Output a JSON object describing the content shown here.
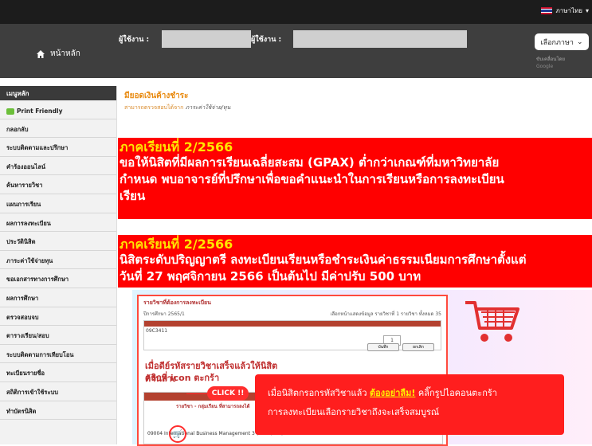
{
  "topbar": {
    "language_label": "ภาษาไทย",
    "chevron": "chevron-down-icon"
  },
  "header": {
    "home_label": "หน้าหลัก",
    "user_label_1": "ผู้ใช้งาน :",
    "user_label_2": "ผู้ใช้งาน : ",
    "language_select": "เลือกภาษา",
    "powered_by": "ขับเคลื่อนโดย",
    "google": "Google"
  },
  "sidebar": {
    "heading": "เมนูหลัก",
    "items": [
      "Print Friendly",
      "กลอกลับ",
      "ระบบติดตามและปรึกษา",
      "คำร้องออนไลน์",
      "ค้นหารายวิชา",
      "แผนการเรียน",
      "ผลการลงทะเบียน",
      "ประวัตินิสิต",
      "ภาระค่าใช้จ่ายทุน",
      "ขอเอกสารทางการศึกษา",
      "ผลการศึกษา",
      "ตรวจสอบจบ",
      "ตารางเรียน/สอบ",
      "ระบบติดตามการเทียบโอน",
      "ทะเบียนรายชื่อ",
      "สถิติการเข้าใช้ระบบ",
      "ทำบัตรนิสิต"
    ]
  },
  "notice": {
    "title": "มียอดเงินค้างชำระ",
    "subtitle": "สามารถตรวจสอบได้จาก",
    "subtitle_link": "ภาระค่าใช้จ่าย/ทุน"
  },
  "banner1": {
    "term": "ภาคเรียนที่ 2/2566",
    "lines": [
      "ขอให้นิสิตที่มีผลการเรียนเฉลี่ยสะสม (GPAX) ต่ำกว่าเกณฑ์ที่มหาวิทยาลัย",
      "กำหนด พบอาจารย์ที่ปรึกษาเพื่อขอคำแนะนำในการเรียนหรือการลงทะเบียน",
      "เรียน"
    ]
  },
  "banner2": {
    "term": "ภาคเรียนที่ 2/2566",
    "lines": [
      "นิสิตระดับปริญญาตรี ลงทะเบียนเรียนหรือชำระเงินค่าธรรมเนียมการศึกษาตั้งแต่",
      "วันที่ 27 พฤศจิกายน 2566 เป็นต้นไป มีค่าปรับ 500 บาท"
    ]
  },
  "poster": {
    "frame_title": "รายวิชาที่ต้องการลงทะเบียน",
    "term_row_left": "ปีการศึกษา 2565/1",
    "term_row_right": "เลือกหน้าแสดงข้อมูล  รายวิชาที่ 1  รายวิชา  ทั้งหมด 35",
    "course_code": "09C3411",
    "qty": "1",
    "btn_save": "บันทึก",
    "btn_cancel": "ยกเลิก",
    "big_text_1": "เมื่อดีย์รหัสรายวิชาเสร็จแล้วให้นิสิตคลิกที่ icon ตะกร้า",
    "big_text_2": "ด้านล่าง",
    "click_label": "CLICK !!",
    "group_row": "รายวิชา - กลุ่มเรียน ที่สามารถลงได้",
    "course_row": "09004 International Business Management    3 (3-0-6)  1  5/5  Tu08:00-11:00",
    "speech_line1_a": "เมื่อนิสิตกรอกรหัสวิชาแล้ว",
    "speech_line1_b": "ต้องอย่าลืม!",
    "speech_line1_c": "คลิ๊กรูปไอคอนตะกร้า",
    "speech_line2": "การลงทะเบียนเลือกรายวิชาถึงจะเสร็จสมบูรณ์"
  }
}
